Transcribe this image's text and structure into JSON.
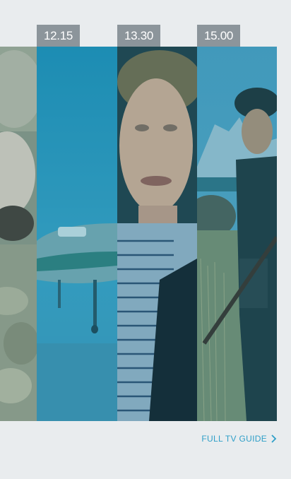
{
  "schedule": {
    "slots": [
      {
        "time": "12.15"
      },
      {
        "time": "13.30"
      },
      {
        "time": "15.00"
      }
    ]
  },
  "footer": {
    "full_guide_label": "FULL TV GUIDE",
    "chevron_icon": "chevron-right-icon"
  },
  "colors": {
    "background": "#e9ecee",
    "time_tag": "#8c959b",
    "link": "#2f9fc8",
    "overlay_teal": "#1f8fb4"
  }
}
